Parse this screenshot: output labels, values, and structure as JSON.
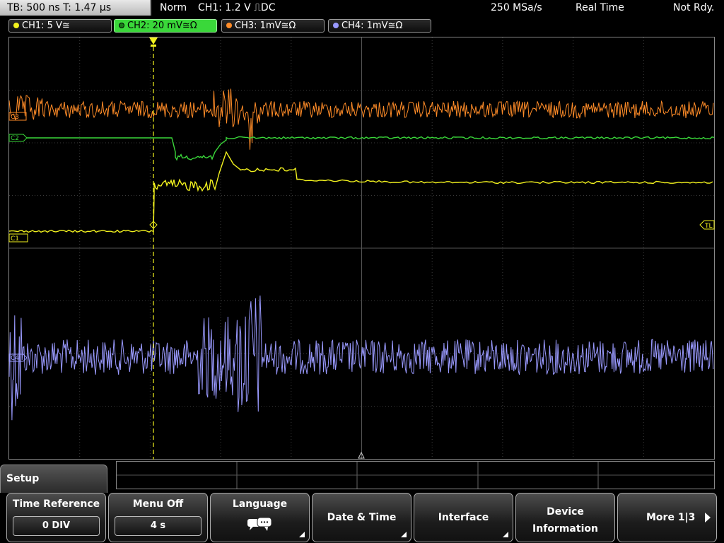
{
  "status_bar": {
    "timebase": "TB: 500 ns   T: 1.47 µs",
    "mode": "Norm",
    "trigger": "CH1: 1.2 V ⎍DC",
    "sample_rate": "250 MSa/s",
    "acq_mode": "Real Time",
    "state": "Not Rdy."
  },
  "channels": [
    {
      "label": "CH1: 5 V≅",
      "color": "#f2f21e",
      "active": false
    },
    {
      "label": "CH2: 20 mV≅Ω",
      "color": "#3ad83a",
      "active": true
    },
    {
      "label": "CH3: 1mV≅Ω",
      "color": "#ff8c28",
      "active": false
    },
    {
      "label": "CH4: 1mV≅Ω",
      "color": "#9a9aff",
      "active": false
    }
  ],
  "markers": {
    "ch3": "C3",
    "ch2": "C2",
    "ch1": "C1",
    "ch4": "C4",
    "trigger_level": "TL"
  },
  "menu": {
    "title": "Setup",
    "softkeys": [
      {
        "label": "Time Reference",
        "value": "0 DIV"
      },
      {
        "label": "Menu Off",
        "value": "4 s"
      },
      {
        "label": "Language",
        "icon": "speech-bubbles-icon"
      },
      {
        "label": "Date & Time"
      },
      {
        "label": "Interface"
      },
      {
        "label": "Device Information"
      },
      {
        "label": "More 1|3",
        "icon": "right-arrow-icon"
      }
    ]
  }
}
